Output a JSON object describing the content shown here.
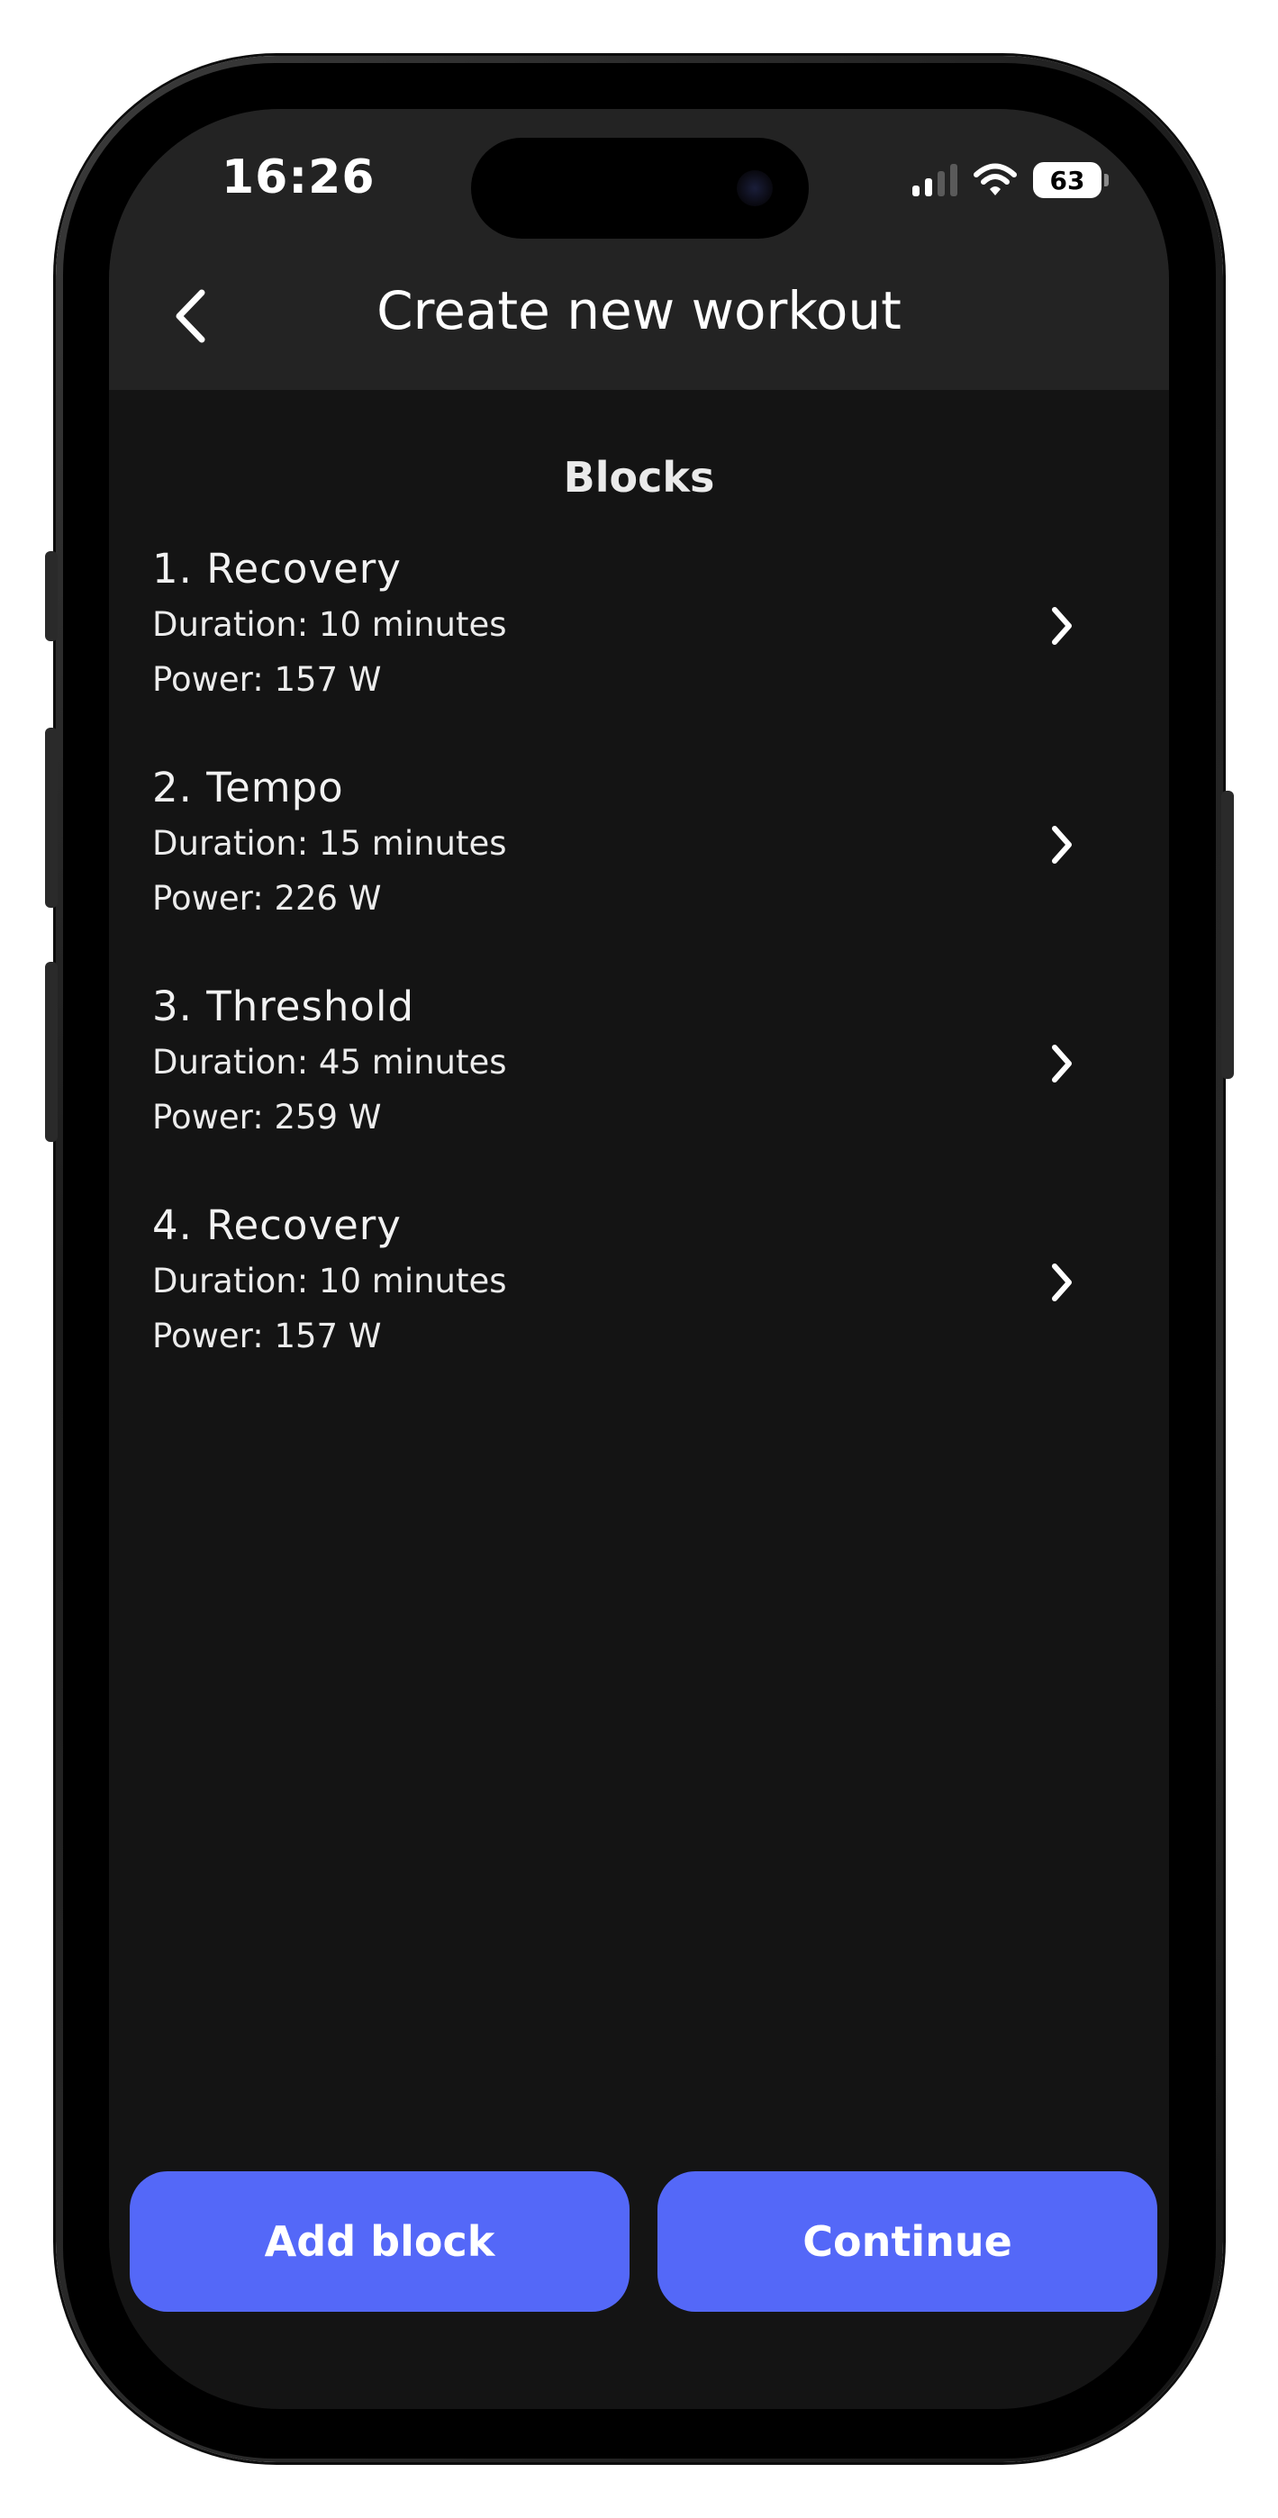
{
  "status_bar": {
    "time": "16:26",
    "battery": "63"
  },
  "header": {
    "title": "Create new workout"
  },
  "section": {
    "title": "Blocks"
  },
  "blocks": [
    {
      "title": "1. Recovery",
      "duration": "Duration: 10 minutes",
      "power": "Power: 157 W"
    },
    {
      "title": "2. Tempo",
      "duration": "Duration: 15 minutes",
      "power": "Power: 226 W"
    },
    {
      "title": "3. Threshold",
      "duration": "Duration: 45 minutes",
      "power": "Power: 259 W"
    },
    {
      "title": "4. Recovery",
      "duration": "Duration: 10 minutes",
      "power": "Power: 157 W"
    }
  ],
  "actions": {
    "add_block": "Add block",
    "continue": "Continue"
  },
  "colors": {
    "accent": "#5468f8",
    "background": "#141414",
    "header_background": "#232323"
  }
}
